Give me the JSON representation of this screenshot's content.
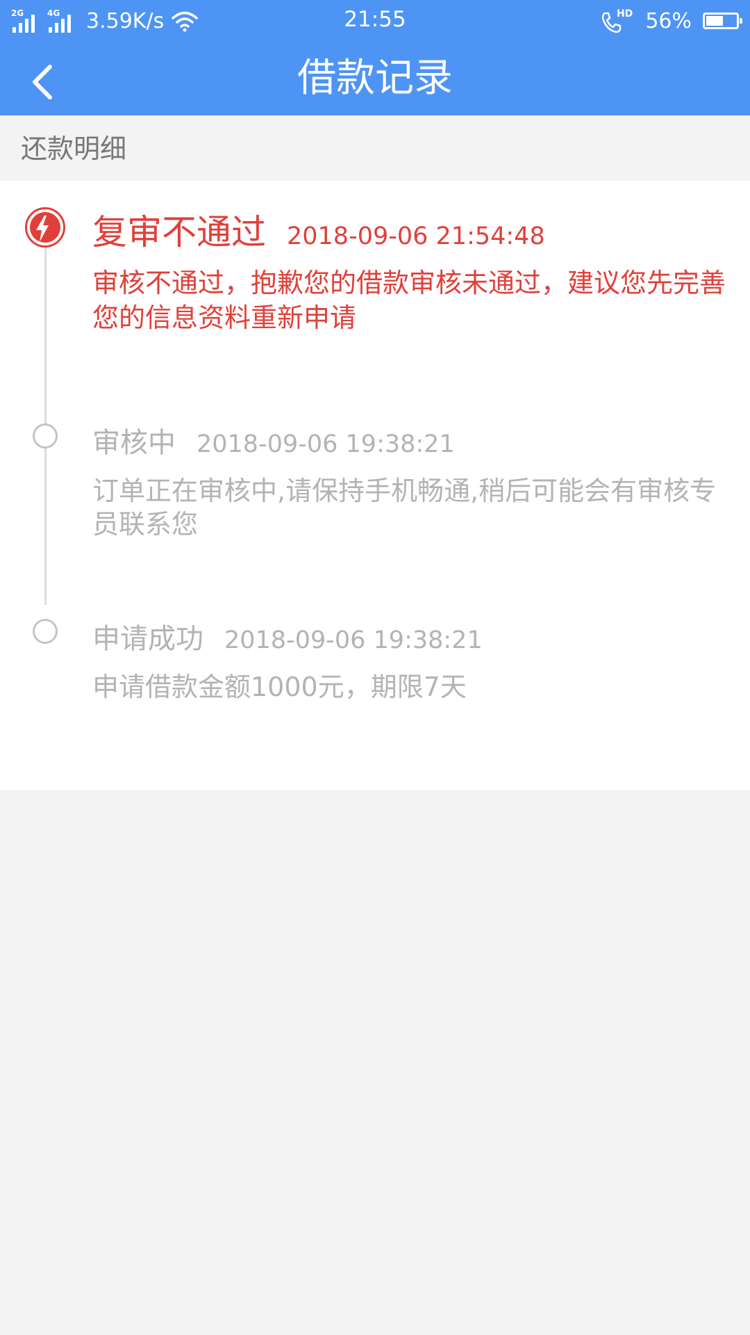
{
  "status_bar": {
    "sim1_network": "2G",
    "sim2_network": "4G",
    "speed": "3.59K/s",
    "time": "21:55",
    "call_badge": "HD",
    "battery_percent_label": "56%",
    "battery_level": 0.56
  },
  "nav": {
    "back_icon": "chevron-left-icon",
    "title": "借款记录"
  },
  "section": {
    "title": "还款明细"
  },
  "timeline": [
    {
      "status": "复审不通过",
      "time": "2018-09-06 21:54:48",
      "description": "审核不通过，抱歉您的借款审核未通过，建议您先完善您的信息资料重新申请",
      "active": true,
      "color": "#e0403a",
      "icon": "lightning-icon"
    },
    {
      "status": "审核中",
      "time": "2018-09-06 19:38:21",
      "description": "订单正在审核中,请保持手机畅通,稍后可能会有审核专员联系您",
      "active": false,
      "color": "#b3b3b3"
    },
    {
      "status": "申请成功",
      "time": "2018-09-06 19:38:21",
      "description": "申请借款金额1000元，期限7天",
      "active": false,
      "color": "#b3b3b3"
    }
  ],
  "colors": {
    "header_blue": "#4d94f5",
    "active_red": "#e0403a",
    "inactive_gray": "#b3b3b3",
    "page_background": "#f3f3f3"
  }
}
